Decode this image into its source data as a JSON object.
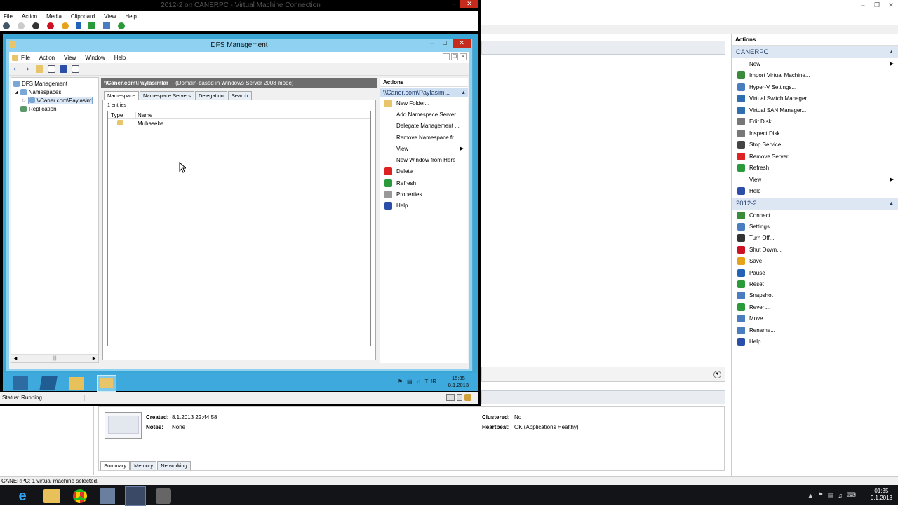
{
  "host": {
    "actions_header": "Actions",
    "group1": "CANERPC",
    "group1_actions": [
      {
        "label": "New",
        "icon": "blank",
        "arrow": true
      },
      {
        "label": "Import Virtual Machine...",
        "icon": "import"
      },
      {
        "label": "Hyper-V Settings...",
        "icon": "settings"
      },
      {
        "label": "Virtual Switch Manager...",
        "icon": "switch"
      },
      {
        "label": "Virtual SAN Manager...",
        "icon": "san"
      },
      {
        "label": "Edit Disk...",
        "icon": "disk"
      },
      {
        "label": "Inspect Disk...",
        "icon": "inspect"
      },
      {
        "label": "Stop Service",
        "icon": "stop"
      },
      {
        "label": "Remove Server",
        "icon": "remove"
      },
      {
        "label": "Refresh",
        "icon": "refresh"
      },
      {
        "label": "View",
        "icon": "blank",
        "arrow": true
      },
      {
        "label": "Help",
        "icon": "help"
      }
    ],
    "group2": "2012-2",
    "group2_actions": [
      {
        "label": "Connect...",
        "icon": "connect"
      },
      {
        "label": "Settings...",
        "icon": "settings"
      },
      {
        "label": "Turn Off...",
        "icon": "turnoff"
      },
      {
        "label": "Shut Down...",
        "icon": "shutdown"
      },
      {
        "label": "Save",
        "icon": "save"
      },
      {
        "label": "Pause",
        "icon": "pause"
      },
      {
        "label": "Reset",
        "icon": "reset"
      },
      {
        "label": "Snapshot",
        "icon": "snapshot"
      },
      {
        "label": "Revert...",
        "icon": "revert"
      },
      {
        "label": "Move...",
        "icon": "move"
      },
      {
        "label": "Rename...",
        "icon": "rename"
      },
      {
        "label": "Help",
        "icon": "help"
      }
    ],
    "details": {
      "created_label": "Created:",
      "created_value": "8.1.2013 22:44:58",
      "notes_label": "Notes:",
      "notes_value": "None",
      "clustered_label": "Clustered:",
      "clustered_value": "No",
      "heartbeat_label": "Heartbeat:",
      "heartbeat_value": "OK (Applications Healthy)"
    },
    "detail_tabs": [
      "Summary",
      "Memory",
      "Networking"
    ],
    "status": "CANERPC:  1 virtual machine selected."
  },
  "vmconnect": {
    "title": "2012-2 on CANERPC - Virtual Machine Connection",
    "menu": [
      "File",
      "Action",
      "Media",
      "Clipboard",
      "View",
      "Help"
    ],
    "status": "Status: Running"
  },
  "dfs": {
    "title": "DFS Management",
    "menu": [
      "File",
      "Action",
      "View",
      "Window",
      "Help"
    ],
    "tree": {
      "root": "DFS Management",
      "namespaces": "Namespaces",
      "ns_item": "\\\\Caner.com\\Paylasiml",
      "replication": "Replication"
    },
    "header_path": "\\\\Caner.com\\Paylasimlar",
    "header_mode": "(Domain-based in Windows Server 2008 mode)",
    "tabs": [
      "Namespace",
      "Namespace Servers",
      "Delegation",
      "Search"
    ],
    "entries": "1 entries",
    "columns": [
      "Type",
      "Name"
    ],
    "rows": [
      {
        "name": "Muhasebe"
      }
    ],
    "actions_header": "Actions",
    "actions_group": "\\\\Caner.com\\Paylasim...",
    "actions": [
      {
        "label": "New Folder...",
        "icon": "folder"
      },
      {
        "label": "Add Namespace Server...",
        "icon": "blank"
      },
      {
        "label": "Delegate Management ...",
        "icon": "blank"
      },
      {
        "label": "Remove Namespace fr...",
        "icon": "blank"
      },
      {
        "label": "View",
        "icon": "blank",
        "arrow": true
      },
      {
        "label": "New Window from Here",
        "icon": "blank"
      },
      {
        "label": "Delete",
        "icon": "delete"
      },
      {
        "label": "Refresh",
        "icon": "refresh"
      },
      {
        "label": "Properties",
        "icon": "properties"
      },
      {
        "label": "Help",
        "icon": "help"
      }
    ]
  },
  "guest_taskbar": {
    "lang": "TUR",
    "time": "15:35",
    "date": "8.1.2013"
  },
  "host_taskbar": {
    "time": "01:35",
    "date": "9.1.2013"
  },
  "icon_colors": {
    "blank": "transparent",
    "import": "#3a8c3a",
    "settings": "#4a7cc0",
    "switch": "#2f6fb0",
    "san": "#2f6fb0",
    "disk": "#777",
    "inspect": "#777",
    "stop": "#444",
    "remove": "#d22",
    "refresh": "#2a9a3a",
    "help": "#2b4fa8",
    "connect": "#3a8c3a",
    "turnoff": "#333",
    "shutdown": "#c12",
    "save": "#e6a21a",
    "pause": "#2263b8",
    "reset": "#2a9a3a",
    "snapshot": "#4a7cc0",
    "revert": "#2a9a3a",
    "move": "#4a7cc0",
    "rename": "#4a7cc0",
    "folder": "#e8c46a",
    "delete": "#d22",
    "properties": "#999"
  }
}
